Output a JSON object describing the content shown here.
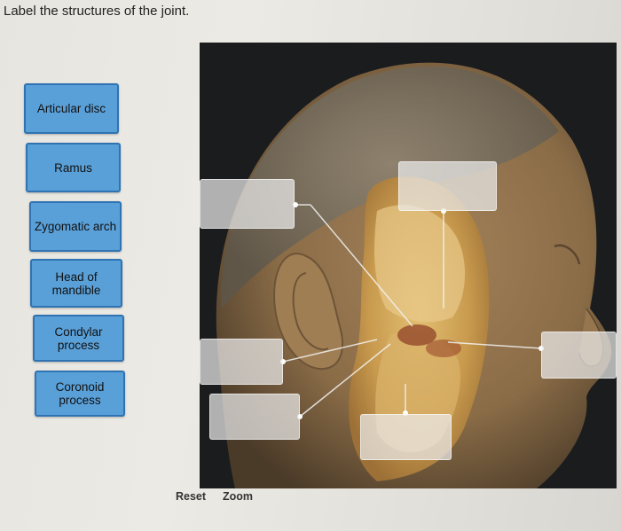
{
  "instruction": "Label the structures of the joint.",
  "labels": [
    {
      "text": "Articular disc"
    },
    {
      "text": "Ramus"
    },
    {
      "text": "Zygomatic arch"
    },
    {
      "text": "Head of\nmandible"
    },
    {
      "text": "Condylar\nprocess"
    },
    {
      "text": "Coronoid\nprocess"
    }
  ],
  "controls": {
    "reset": "Reset",
    "zoom": "Zoom"
  },
  "colors": {
    "label_fill": "#5aa0d8",
    "label_border": "#2f73b3",
    "image_background": "#1b1c1d"
  }
}
